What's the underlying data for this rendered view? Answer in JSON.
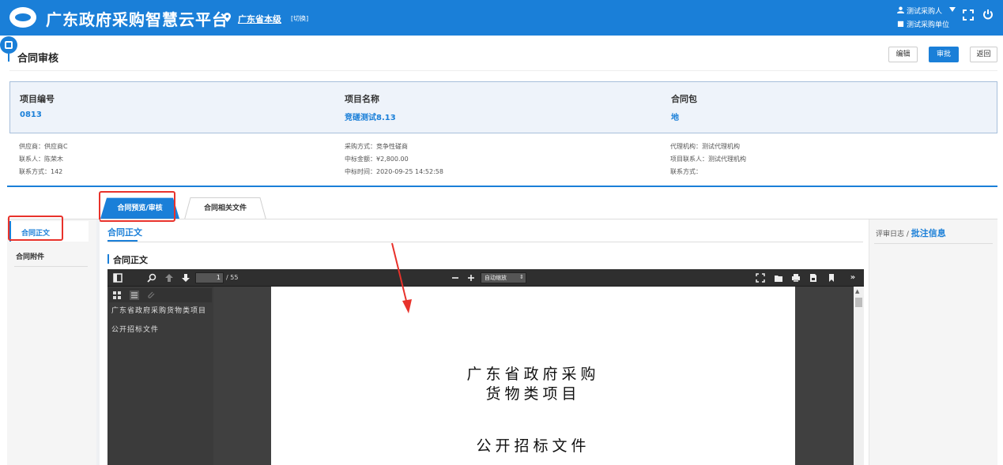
{
  "header": {
    "app_title": "广东政府采购智慧云平台",
    "region": "广东省本级",
    "switch_label": "[切换]",
    "user_name": "测试采购人",
    "user_org": "测试采购单位"
  },
  "page": {
    "title": "合同审核",
    "buttons": {
      "edit": "编辑",
      "approve": "审批",
      "back": "返回"
    }
  },
  "summary": {
    "project_no_label": "项目编号",
    "project_no_value": "0813",
    "project_name_label": "项目名称",
    "project_name_value": "竞磋测试8.13",
    "package_label": "合同包",
    "package_value": "地"
  },
  "details": {
    "col1": [
      "供应商：供应商C",
      "联系人：陈荣木",
      "联系方式：142"
    ],
    "col2": [
      "采购方式：竞争性磋商",
      "中标金额：¥2,800.00",
      "中标时间：2020-09-25 14:52:58"
    ],
    "col3": [
      "代理机构：测试代理机构",
      "项目联系人：测试代理机构",
      "联系方式："
    ]
  },
  "tabs": {
    "active": "合同预览/审核",
    "inactive": "合同相关文件"
  },
  "left_nav": {
    "item1": "合同正文",
    "item2": "合同附件"
  },
  "main": {
    "tab_label": "合同正文",
    "section_title": "合同正文"
  },
  "viewer": {
    "page_current": "1",
    "page_total": "/ 55",
    "zoom": "自动缩放",
    "outline": [
      "广东省政府采购货物类项目",
      "公开招标文件"
    ],
    "page_lines": [
      "广东省政府采购",
      "货物类项目",
      "公开招标文件"
    ]
  },
  "right_panel": {
    "prefix": "评审日志 / ",
    "title": "批注信息"
  },
  "colors": {
    "brand": "#1a7fd8",
    "highlight": "#e8322b"
  }
}
